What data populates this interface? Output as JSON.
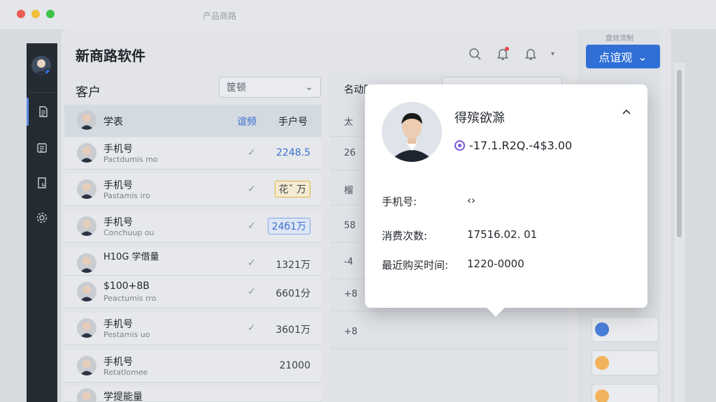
{
  "window": {
    "title": "产品商路"
  },
  "app": {
    "title": "新商路软件"
  },
  "section": {
    "title": "客户",
    "filter_label": "筐顿"
  },
  "list_header": {
    "col1": "学表",
    "col2": "谊频",
    "col3": "手户号"
  },
  "rows": [
    {
      "name": "手机号",
      "sub": "Pactdumis mo",
      "value": "2248.5",
      "style": "blue"
    },
    {
      "name": "手机号",
      "sub": "Pastamis iro",
      "value": "花ˇ 万",
      "style": "box-yellow"
    },
    {
      "name": "手机号",
      "sub": "Conchuup ou",
      "value": "24б1万",
      "style": "box-blue"
    },
    {
      "name": "H10G 学借量",
      "sub": "",
      "value": "1321万",
      "style": ""
    },
    {
      "name": "$100+8B",
      "sub": "Peactumis rro",
      "value": "6601分",
      "style": ""
    },
    {
      "name": "手机号",
      "sub": "Pestamis uo",
      "value": "3601万",
      "style": ""
    },
    {
      "name": "手机号",
      "sub": "Retatlomee",
      "value": "21000",
      "style": ""
    },
    {
      "name": "学提能量",
      "sub": "",
      "value": "",
      "style": ""
    }
  ],
  "middle": {
    "title": "名动阳额",
    "rows": [
      "太",
      "26",
      "榴",
      "58",
      "-4",
      "+8",
      "+8",
      ""
    ]
  },
  "right_panel": {
    "top_label": "盘效流制",
    "cta_label": "点谊观"
  },
  "popover": {
    "name": "得殡欲滁",
    "spend": "-17.1.R2Q.-4$3.00",
    "phone_label": "手机号:",
    "phone_value": "‹›",
    "count_label": "消费次数:",
    "count_value": "17516.02. 01",
    "last_label": "最近购买时间:",
    "last_value": "1220-0000"
  },
  "colors": {
    "accent": "#2f6fd6",
    "sidebar": "#252b33",
    "notify": "#e84a4a"
  },
  "icons": [
    "search-icon",
    "bell-icon",
    "document-icon",
    "list-icon",
    "file-icon",
    "settings-icon",
    "chevron-up-icon",
    "chevron-down-icon",
    "check-icon"
  ]
}
